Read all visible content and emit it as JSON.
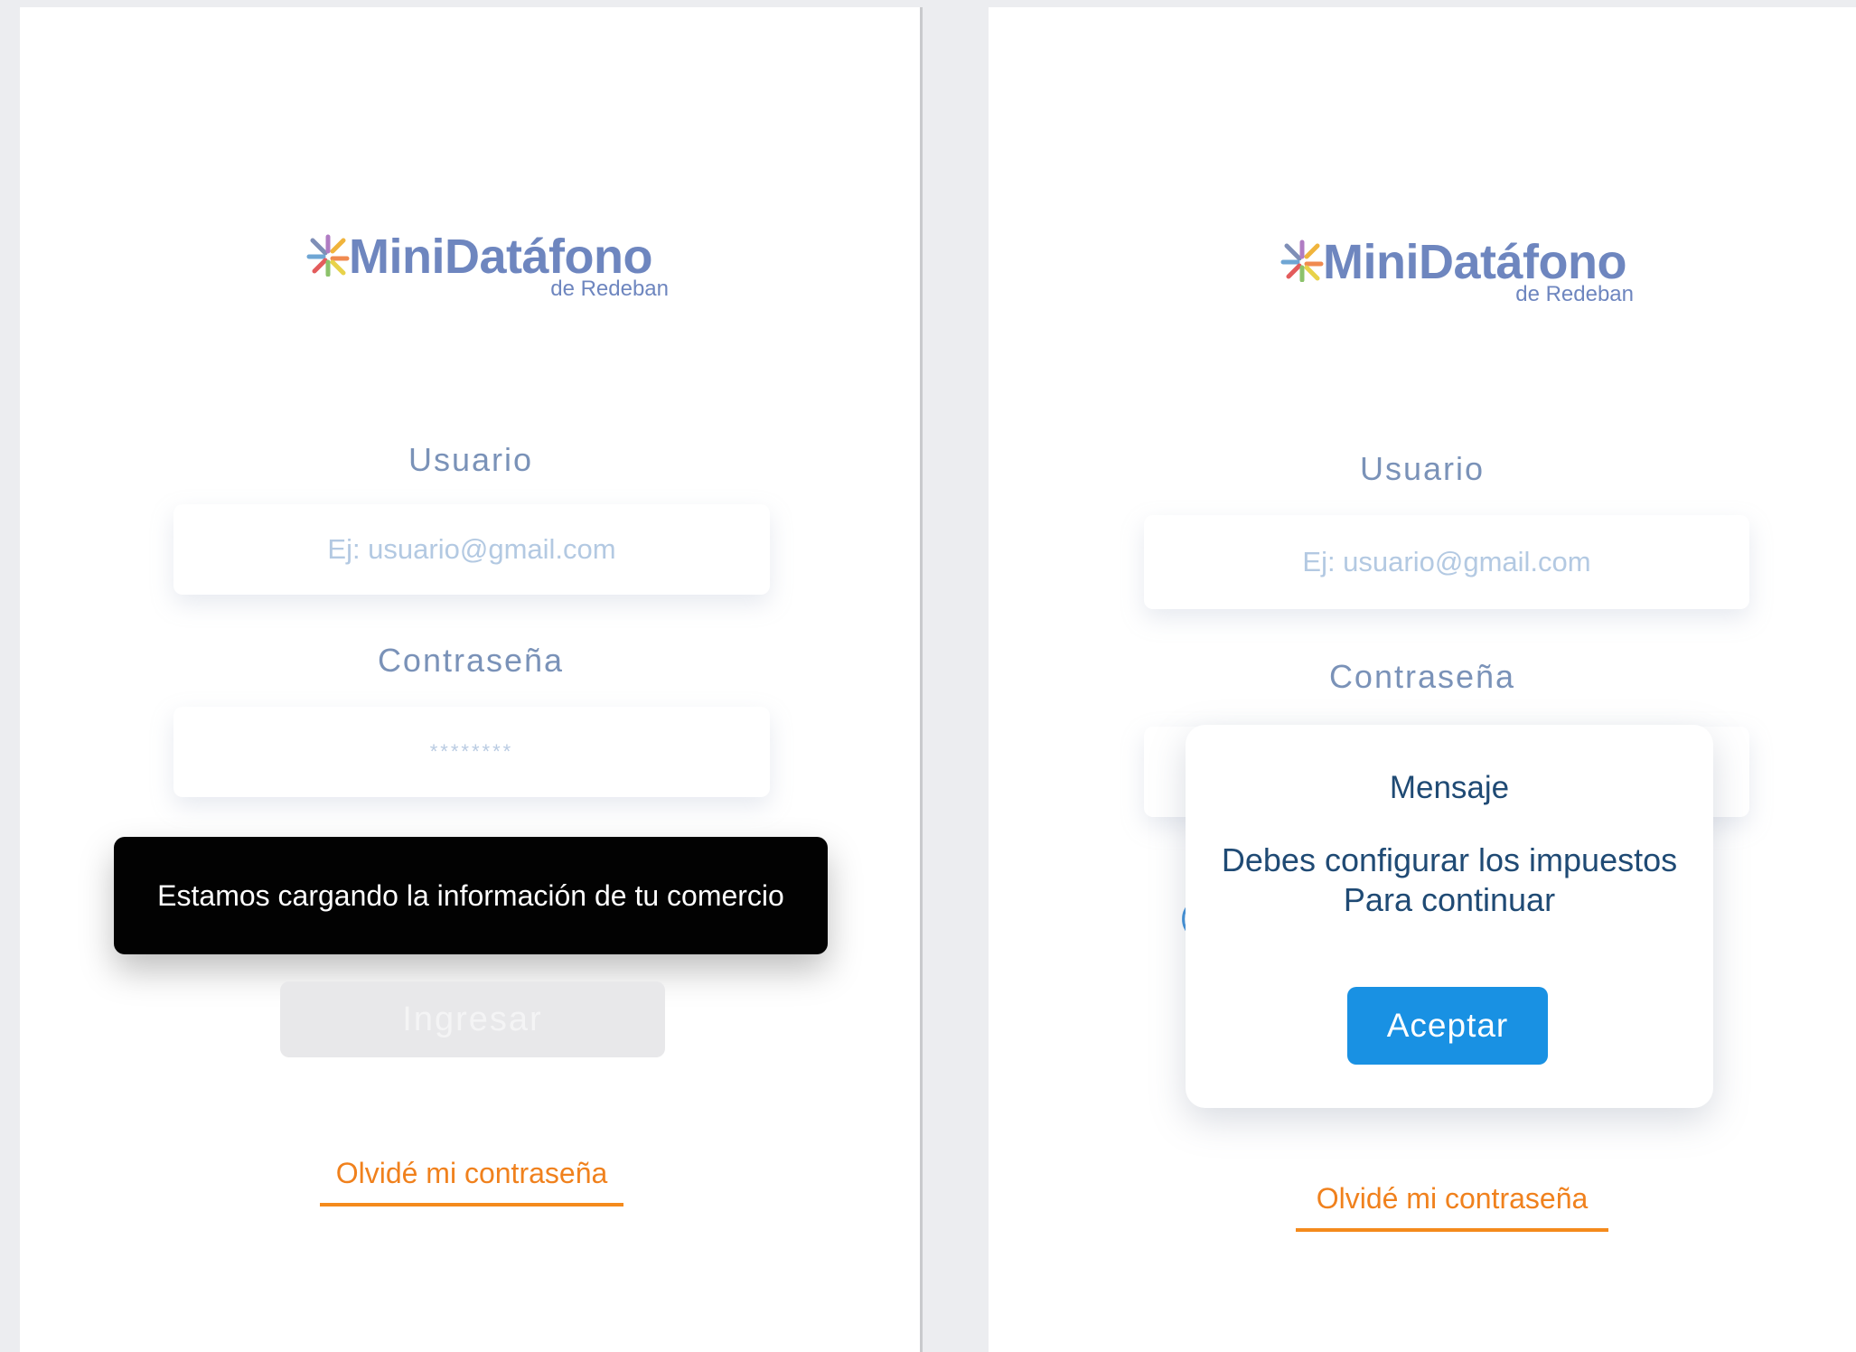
{
  "left_screen": {
    "logo": {
      "brand": "MiniDatáfono",
      "sub": "de Redeban"
    },
    "username": {
      "label": "Usuario",
      "placeholder": "Ej: usuario@gmail.com"
    },
    "password": {
      "label": "Contraseña",
      "value": "********"
    },
    "toast": {
      "text": "Estamos cargando la información de tu comercio"
    },
    "login_button": {
      "label": "Ingresar"
    },
    "forgot_link": {
      "label": "Olvidé mi contraseña"
    }
  },
  "right_screen": {
    "logo": {
      "brand": "MiniDatáfono",
      "sub": "de Redeban"
    },
    "username": {
      "label": "Usuario",
      "placeholder": "Ej: usuario@gmail.com"
    },
    "password": {
      "label": "Contraseña"
    },
    "dialog": {
      "title": "Mensaje",
      "message_line1": "Debes configurar los impuestos",
      "message_line2": "Para continuar",
      "accept_label": "Aceptar"
    },
    "forgot_link": {
      "label": "Olvidé mi contraseña"
    }
  },
  "colors": {
    "brand": "#6e86bf",
    "accent_orange": "#f48a1c",
    "primary_button": "#1991e3",
    "toast_bg": "#020202"
  }
}
